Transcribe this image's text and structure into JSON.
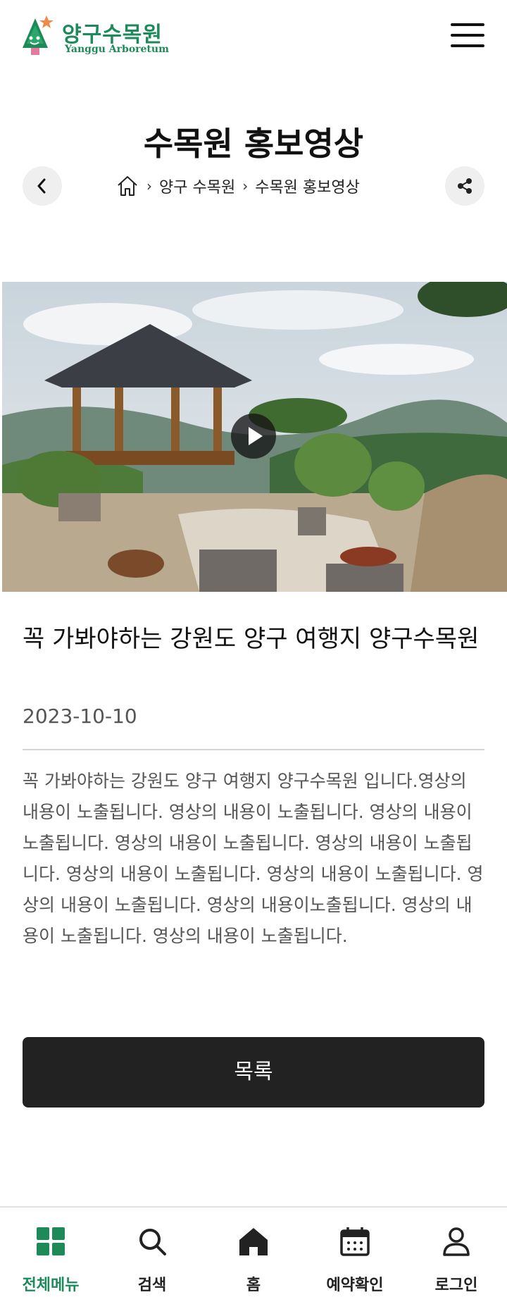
{
  "header": {
    "logo_ko": "양구수목원",
    "logo_en": "Yanggu Arboretum",
    "menu_icon": "hamburger-menu-icon"
  },
  "page": {
    "title": "수목원 홍보영상",
    "back_icon": "chevron-left-icon",
    "share_icon": "share-icon"
  },
  "breadcrumb": {
    "home_icon": "home-icon",
    "items": [
      "양구 수목원",
      "수목원 홍보영상"
    ]
  },
  "video": {
    "play_icon": "play-icon"
  },
  "post": {
    "title": "꼭 가봐야하는 강원도 양구 여행지 양구수목원",
    "date": "2023-10-10",
    "body": "꼭 가봐야하는 강원도 양구 여행지 양구수목원 입니다.영상의 내용이 노출됩니다. 영상의 내용이 노출됩니다. 영상의 내용이 노출됩니다. 영상의 내용이 노출됩니다. 영상의 내용이 노출됩니다. 영상의 내용이 노출됩니다. 영상의 내용이 노출됩니다. 영상의 내용이 노출됩니다. 영상의 내용이노출됩니다. 영상의 내용이 노출됩니다. 영상의 내용이 노출됩니다."
  },
  "list_button": {
    "label": "목록"
  },
  "bottom_nav": {
    "items": [
      {
        "label": "전체메뉴",
        "icon": "grid-icon",
        "active": true
      },
      {
        "label": "검색",
        "icon": "search-icon",
        "active": false
      },
      {
        "label": "홈",
        "icon": "home-icon",
        "active": false
      },
      {
        "label": "예약확인",
        "icon": "calendar-icon",
        "active": false
      },
      {
        "label": "로그인",
        "icon": "user-icon",
        "active": false
      }
    ]
  },
  "colors": {
    "brand_green": "#1e8a5a",
    "button_dark": "#222222"
  }
}
